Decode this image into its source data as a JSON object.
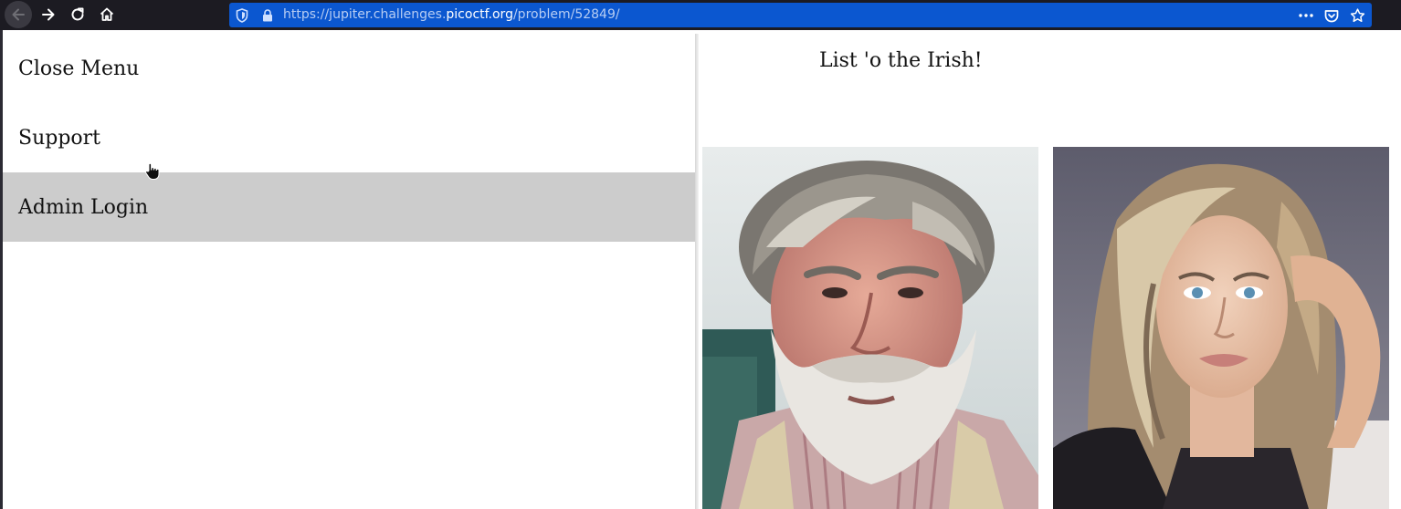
{
  "browser": {
    "url_prefix": "https://jupiter.challenges.",
    "url_domain": "picoctf.org",
    "url_path": "/problem/52849/",
    "icons": [
      "back-arrow-icon",
      "forward-arrow-icon",
      "reload-icon",
      "home-icon",
      "shield-icon",
      "lock-icon",
      "more-icon",
      "pocket-icon",
      "star-icon"
    ],
    "colors": {
      "toolbar": "#1c1b22",
      "urlbar": "#0b57d0"
    }
  },
  "menu": {
    "items": [
      {
        "label": "Close Menu"
      },
      {
        "label": "Support"
      },
      {
        "label": "Admin Login"
      }
    ],
    "hovered_index": 2
  },
  "main": {
    "heading": "List 'o the Irish!",
    "photos": [
      {
        "subject": "bearded-older-man-portrait"
      },
      {
        "subject": "blonde-woman-portrait"
      }
    ]
  }
}
